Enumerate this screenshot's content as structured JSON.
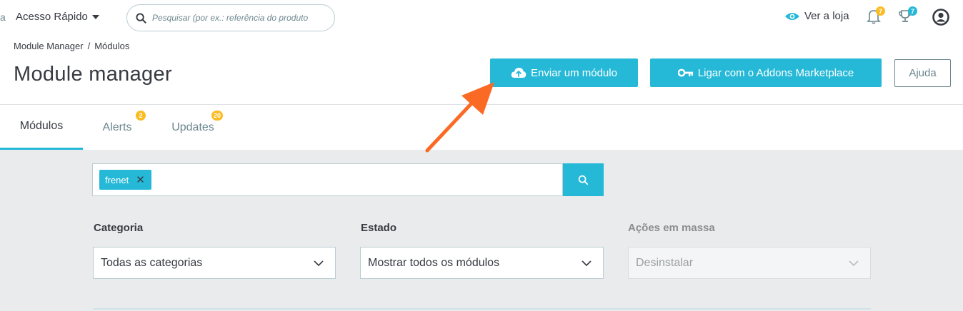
{
  "topbar": {
    "edge_glyph": "a",
    "quick_access_label": "Acesso Rápido",
    "search_placeholder": "Pesquisar (por ex.: referência do produto",
    "view_store_label": "Ver a loja",
    "notifications": [
      {
        "icon": "bell-icon",
        "count": "7",
        "color": "#fbbb22"
      },
      {
        "icon": "trophy-icon",
        "count": "7",
        "color": "#25b9d7"
      }
    ]
  },
  "breadcrumb": {
    "items": [
      "Module Manager",
      "Módulos"
    ],
    "separator": "/"
  },
  "page_title": "Module manager",
  "toolbar": {
    "upload_label": "Enviar um módulo",
    "addons_label": "Ligar com o Addons Marketplace",
    "help_label": "Ajuda"
  },
  "tabs": [
    {
      "label": "Módulos",
      "badge": "",
      "active": true
    },
    {
      "label": "Alerts",
      "badge": "2",
      "active": false
    },
    {
      "label": "Updates",
      "badge": "20",
      "active": false
    }
  ],
  "filters": {
    "search_tag": "frenet",
    "category": {
      "label": "Categoria",
      "value": "Todas as categorias"
    },
    "state": {
      "label": "Estado",
      "value": "Mostrar todos os módulos"
    },
    "bulk": {
      "label": "Ações em massa",
      "value": "Desinstalar",
      "disabled": true
    }
  },
  "colors": {
    "accent": "#25b9d7",
    "badge": "#fbbb22",
    "annotation_arrow": "#fb6a25",
    "text": "#363a41",
    "muted": "#6c868e",
    "content_bg": "#eaebec"
  }
}
